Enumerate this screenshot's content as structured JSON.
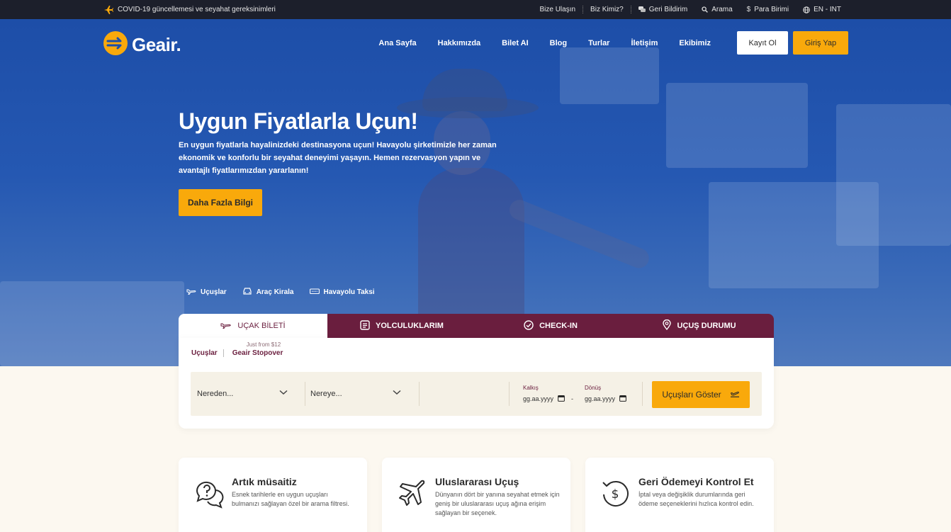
{
  "topbar": {
    "notice": "COVID-19 güncellemesi ve seyahat gereksinimleri",
    "links": [
      "Bize Ulaşın",
      "Biz Kimiz?",
      "Geri Bildirim",
      "Arama",
      "Para Birimi",
      "EN - INT"
    ]
  },
  "brand": {
    "name": "Geair.",
    "accent": "#f9a90b",
    "primary": "#6a1e3e"
  },
  "nav": {
    "items": [
      "Ana Sayfa",
      "Hakkımızda",
      "Bilet AI",
      "Blog",
      "Turlar",
      "İletişim",
      "Ekibimiz"
    ],
    "register": "Kayıt Ol",
    "login": "Giriş Yap"
  },
  "hero": {
    "title": "Uygun Fiyatlarla Uçun!",
    "description": "En uygun fiyatlarla hayalinizdeki destinasyona uçun! Havayolu şirketimizle her zaman ekonomik ve konforlu bir seyahat deneyimi yaşayın. Hemen rezervasyon yapın ve avantajlı fiyatlarımızdan yararlanın!",
    "cta": "Daha Fazla Bilgi"
  },
  "modes": [
    {
      "label": "Uçuşlar",
      "icon": "plane-icon"
    },
    {
      "label": "Araç Kirala",
      "icon": "car-icon"
    },
    {
      "label": "Havayolu Taksi",
      "icon": "taxi-icon"
    }
  ],
  "tabs": [
    {
      "label": "UÇAK BİLETİ",
      "icon": "plane-icon"
    },
    {
      "label": "YOLCULUKLARIM",
      "icon": "list-icon"
    },
    {
      "label": "CHECK-IN",
      "icon": "check-circle-icon"
    },
    {
      "label": "UÇUŞ DURUMU",
      "icon": "location-icon"
    }
  ],
  "booking": {
    "subtab_flights": "Uçuşlar",
    "subtab_stopover": "Geair Stopover",
    "stopover_note": "Just from $12",
    "from_placeholder": "Nereden...",
    "to_placeholder": "Nereye...",
    "depart_label": "Kalkış",
    "return_label": "Dönüş",
    "depart_value": "gg.aa.yyyy",
    "return_value": "gg.aa.yyyy",
    "date_separator": "-",
    "submit": "Uçuşları Göster"
  },
  "features": [
    {
      "title": "Artık müsaitiz",
      "desc": "Esnek tarihlerle en uygun uçuşları bulmanızı sağlayan özel bir arama filtresi.",
      "icon": "chat-question-icon"
    },
    {
      "title": "Uluslararası Uçuş",
      "desc": "Dünyanın dört bir yanına seyahat etmek için geniş bir uluslararası uçuş ağına erişim sağlayan bir seçenek.",
      "icon": "airplane-icon"
    },
    {
      "title": "Geri Ödemeyi Kontrol Et",
      "desc": "İptal veya değişiklik durumlarında geri ödeme seçeneklerini hızlıca kontrol edin.",
      "icon": "refund-icon"
    }
  ]
}
